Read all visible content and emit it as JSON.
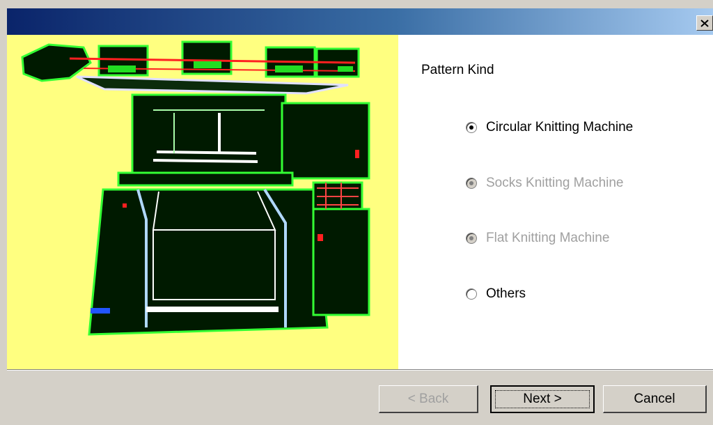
{
  "titlebar": {
    "close_icon": "close-icon"
  },
  "options": {
    "group_label": "Pattern Kind",
    "items": [
      {
        "label": "Circular Knitting Machine",
        "checked": true,
        "disabled": false
      },
      {
        "label": "Socks Knitting Machine",
        "checked": true,
        "disabled": true
      },
      {
        "label": "Flat Knitting Machine",
        "checked": true,
        "disabled": true
      },
      {
        "label": "Others",
        "checked": false,
        "disabled": false
      }
    ]
  },
  "buttons": {
    "back_label": "< Back",
    "next_label": "Next >",
    "cancel_label": "Cancel"
  },
  "colors": {
    "image_background": "#ffff80",
    "machine_outline": "#33ff33",
    "titlebar_start": "#0a246a"
  }
}
